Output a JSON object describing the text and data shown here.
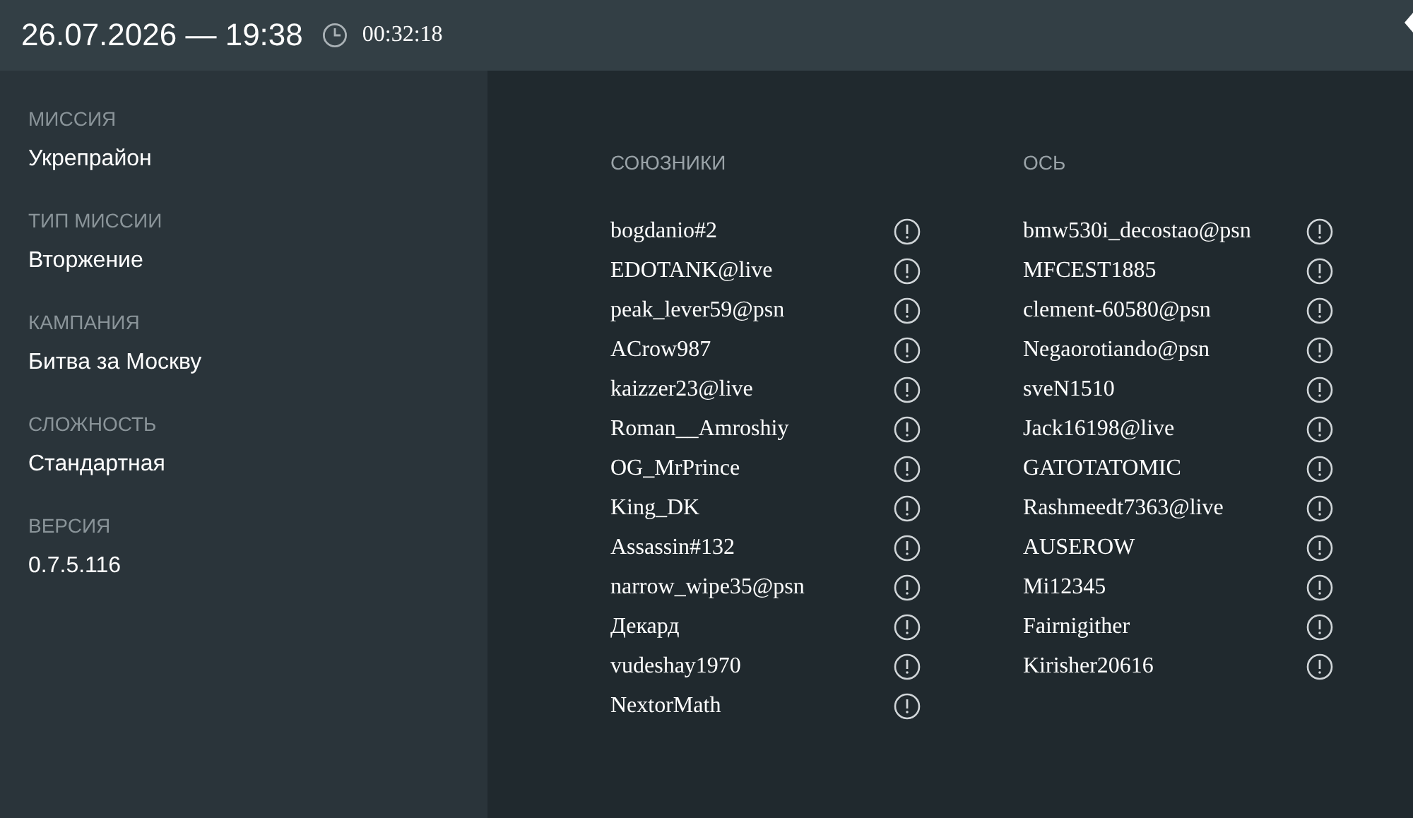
{
  "header": {
    "datetime": "26.07.2026 — 19:38",
    "duration": "00:32:18"
  },
  "details": [
    {
      "label": "МИССИЯ",
      "value": "Укрепрайон"
    },
    {
      "label": "ТИП МИССИИ",
      "value": "Вторжение"
    },
    {
      "label": "КАМПАНИЯ",
      "value": "Битва за Москву"
    },
    {
      "label": "СЛОЖНОСТЬ",
      "value": "Стандартная"
    },
    {
      "label": "ВЕРСИЯ",
      "value": "0.7.5.116"
    }
  ],
  "teams": [
    {
      "title": "СОЮЗНИКИ",
      "players": [
        "bogdanio#2",
        "EDOTANK@live",
        "peak_lever59@psn",
        "ACrow987",
        "kaizzer23@live",
        "Roman__Amroshiy",
        "OG_MrPrince",
        "King_DK",
        "Assassin#132",
        "narrow_wipe35@psn",
        "Декард",
        "vudeshay1970",
        "NextorMath"
      ]
    },
    {
      "title": "ОСЬ",
      "players": [
        "bmw530i_decostao@psn",
        "MFCEST1885",
        "clement-60580@psn",
        "Negaorotiando@psn",
        "sveN1510",
        "Jack16198@live",
        "GATOTATOMIC",
        "Rashmeedt7363@live",
        "AUSEROW",
        "Mi12345",
        "Fairnigither",
        "Kirisher20616"
      ]
    }
  ]
}
